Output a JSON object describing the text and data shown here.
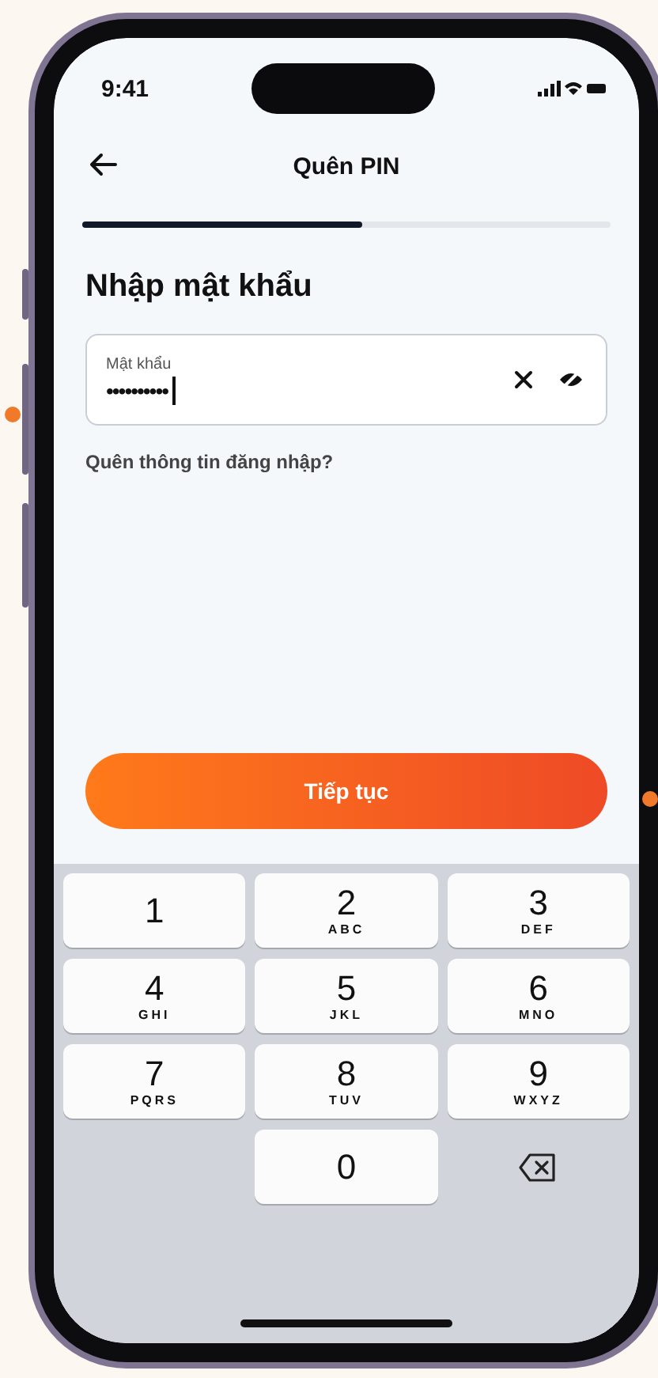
{
  "status_bar": {
    "time": "9:41"
  },
  "nav": {
    "title": "Quên PIN"
  },
  "progress": {
    "level": 0.53
  },
  "heading": "Nhập mật khẩu",
  "password_field": {
    "label": "Mật khẩu",
    "value": "••••••••••"
  },
  "forgot_link": "Quên thông tin đăng nhập?",
  "continue_button": "Tiếp tục",
  "keypad": [
    {
      "kind": "digit",
      "digit": "1"
    },
    {
      "kind": "digit",
      "digit": "2",
      "letters": "ABC"
    },
    {
      "kind": "digit",
      "digit": "3",
      "letters": "DEF"
    },
    {
      "kind": "digit",
      "digit": "4",
      "letters": "GHI"
    },
    {
      "kind": "digit",
      "digit": "5",
      "letters": "JKL"
    },
    {
      "kind": "digit",
      "digit": "6",
      "letters": "MNO"
    },
    {
      "kind": "digit",
      "digit": "7",
      "letters": "PQRS"
    },
    {
      "kind": "digit",
      "digit": "8",
      "letters": "TUV"
    },
    {
      "kind": "digit",
      "digit": "9",
      "letters": "WXYZ"
    },
    {
      "kind": "blank"
    },
    {
      "kind": "digit",
      "digit": "0"
    },
    {
      "kind": "backspace"
    }
  ]
}
